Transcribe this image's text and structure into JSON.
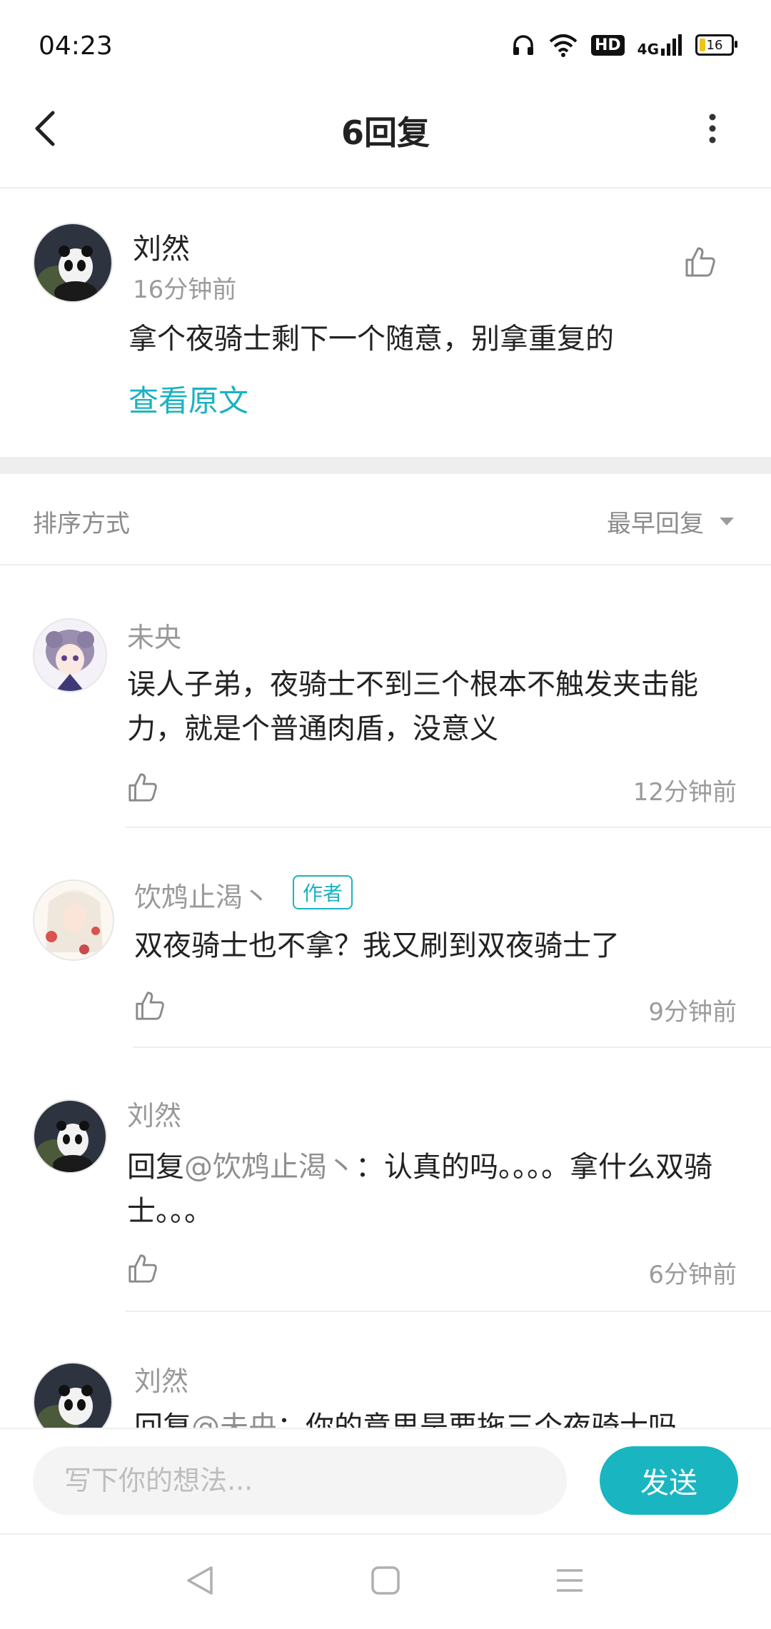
{
  "status_bar": {
    "time": "04:23",
    "network": "4G",
    "hd": "HD",
    "battery": "16"
  },
  "header": {
    "title": "6回复"
  },
  "post": {
    "author": "刘然",
    "time": "16分钟前",
    "text": "拿个夜骑士剩下一个随意，别拿重复的",
    "view_original": "查看原文"
  },
  "sort": {
    "label": "排序方式",
    "value": "最早回复"
  },
  "replies": [
    {
      "name": "未央",
      "text": "误人子弟，夜骑士不到三个根本不触发夹击能力，就是个普通肉盾，没意义",
      "time": "12分钟前"
    },
    {
      "name": "饮鸩止渴丶",
      "badge": "作者",
      "text": "双夜骑士也不拿？我又刷到双夜骑士了",
      "time": "9分钟前"
    },
    {
      "name": "刘然",
      "reply_prefix": "回复",
      "mention": "@饮鸩止渴丶",
      "text": "：认真的吗。。。。拿什么双骑士。。。",
      "time": "6分钟前"
    },
    {
      "name": "刘然",
      "reply_prefix": "回复",
      "mention": "@未央",
      "text": "：你的意思是要拖三个夜骑士吗"
    }
  ],
  "composer": {
    "placeholder": "写下你的想法...",
    "send_label": "发送"
  },
  "colors": {
    "accent": "#19b2c2",
    "divider": "#eeeeee",
    "secondary_text": "#9b9b9b"
  },
  "icons": [
    "back-icon",
    "more-icon",
    "like-icon",
    "sort-caret-icon",
    "nav-back-icon",
    "nav-home-icon",
    "nav-menu-icon"
  ]
}
